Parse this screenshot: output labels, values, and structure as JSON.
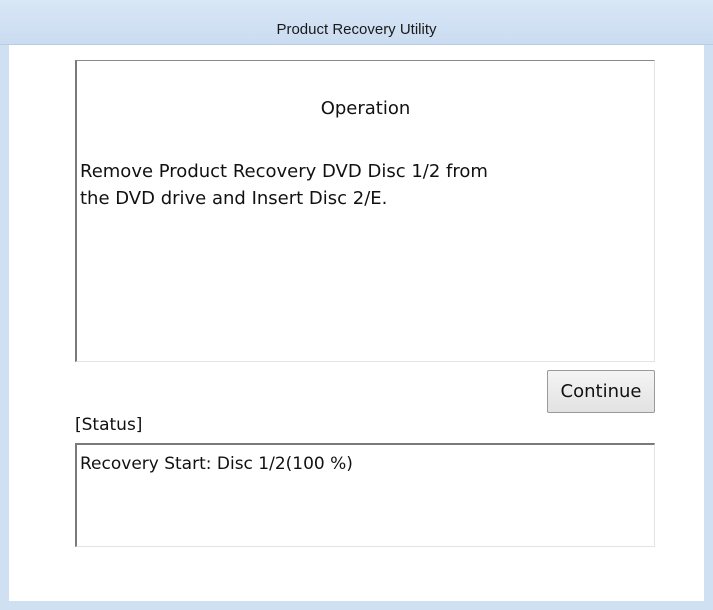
{
  "window": {
    "title": "Product Recovery Utility"
  },
  "operation": {
    "heading": "Operation",
    "message": "Remove Product Recovery DVD Disc 1/2 from\nthe DVD drive and Insert Disc 2/E."
  },
  "actions": {
    "continue_label": "Continue"
  },
  "status": {
    "label": "[Status]",
    "text": "Recovery Start: Disc 1/2(100 %)"
  },
  "colors": {
    "frame": "#cfe0f3",
    "title_bar": "#d3e3f5",
    "background": "#ffffff",
    "border_dark": "#7a7a7a"
  }
}
